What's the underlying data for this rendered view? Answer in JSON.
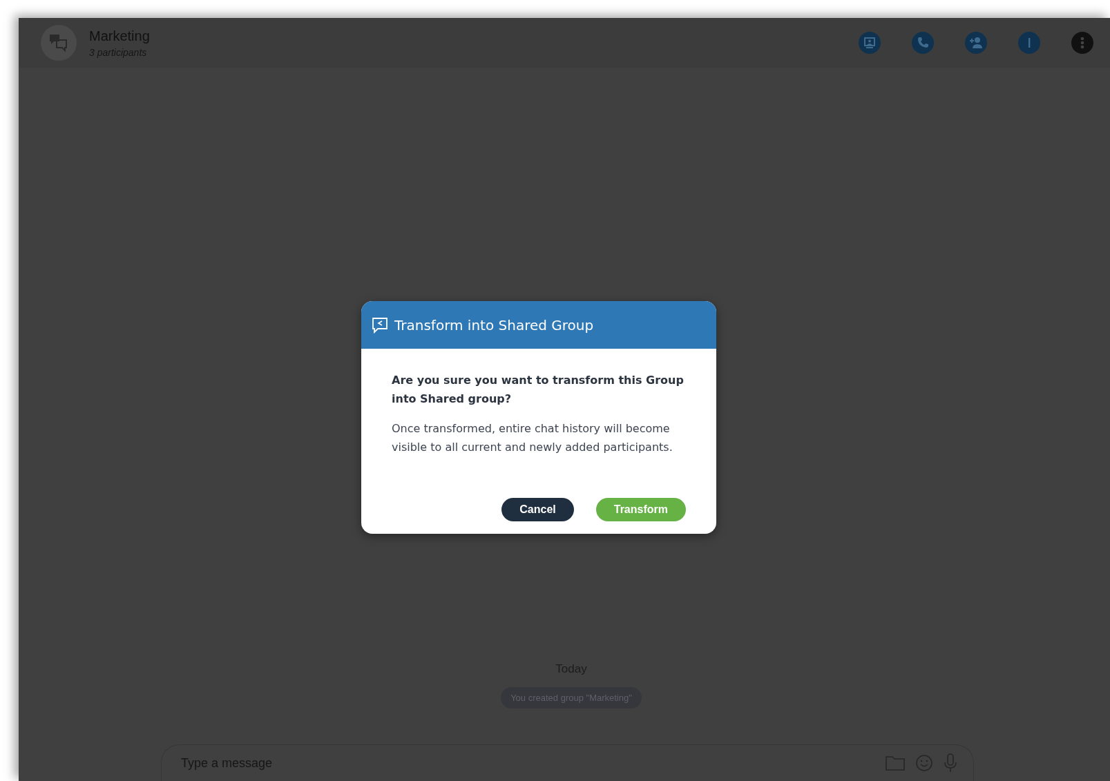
{
  "chat_header": {
    "title": "Marketing",
    "subtitle": "3 participants"
  },
  "conversation": {
    "date_label": "Today",
    "system_message": "You created group \"Marketing\""
  },
  "composer": {
    "placeholder": "Type a message"
  },
  "dialog": {
    "title": "Transform into Shared Group",
    "question": "Are you sure you want to transform this Group into Shared group?",
    "description": "Once transformed, entire chat history will become visible to all current and newly added participants.",
    "buttons": [
      {
        "label": "Cancel",
        "kind": "secondary"
      },
      {
        "label": "Transform",
        "kind": "primary"
      }
    ]
  }
}
